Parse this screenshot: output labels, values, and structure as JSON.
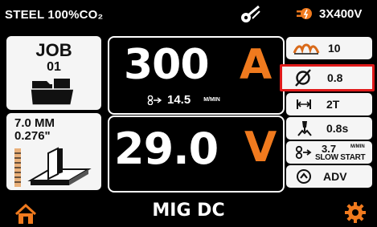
{
  "header": {
    "title": "STEEL 100%CO₂",
    "wire_icon": "wire-spool-icon",
    "power_icon": "plug-icon",
    "power": "3X400V"
  },
  "left": {
    "job": {
      "label": "JOB",
      "number": "01",
      "icon": "folder-icon"
    },
    "thickness": {
      "metric": "7.0  MM",
      "imperial": "0.276\"",
      "icon": "t-joint-icon"
    }
  },
  "center": {
    "current": {
      "value": "300",
      "unit": "A"
    },
    "wire_speed": {
      "value": "14.5",
      "unit": "M/MIN",
      "icon": "wire-feed-icon"
    },
    "voltage": {
      "value": "29.0",
      "unit": "V"
    }
  },
  "right": {
    "inductance": {
      "value": "10",
      "icon": "inductance-icon"
    },
    "wire_diameter": {
      "value": "0.8",
      "icon": "diameter-icon"
    },
    "trigger_mode": {
      "value": "2T",
      "icon": "trigger-icon"
    },
    "burnback": {
      "value": "0.8s",
      "icon": "burnback-icon"
    },
    "slow_start": {
      "value": "3.7",
      "unit": "M/MIN",
      "label": "SLOW START",
      "icon": "slow-start-icon"
    },
    "adv": {
      "label": "ADV",
      "icon": "arrow-circle-icon"
    }
  },
  "footer": {
    "mode": "MIG DC",
    "home_icon": "home-icon",
    "settings_icon": "gear-icon"
  },
  "colors": {
    "accent": "#f07a1e",
    "highlight": "#e01a1a",
    "background": "#000000",
    "panel": "#f5f5f5"
  }
}
